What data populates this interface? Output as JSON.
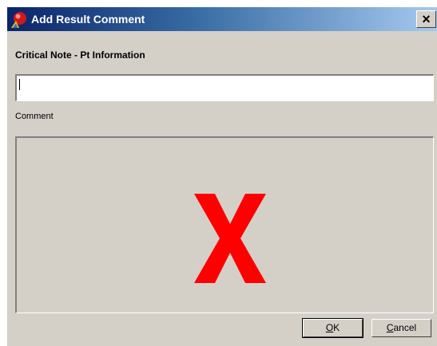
{
  "window": {
    "title": "Add Result Comment",
    "close_glyph": "×",
    "icon": "app-orb-icon"
  },
  "form": {
    "section_label": "Critical Note - Pt Information",
    "input_value": "",
    "comment_label": "Comment",
    "comment_placeholder_icon": "missing-content-x-icon",
    "x_color": "#ff0000"
  },
  "buttons": {
    "ok_label": "OK",
    "cancel_label": "Cancel"
  }
}
